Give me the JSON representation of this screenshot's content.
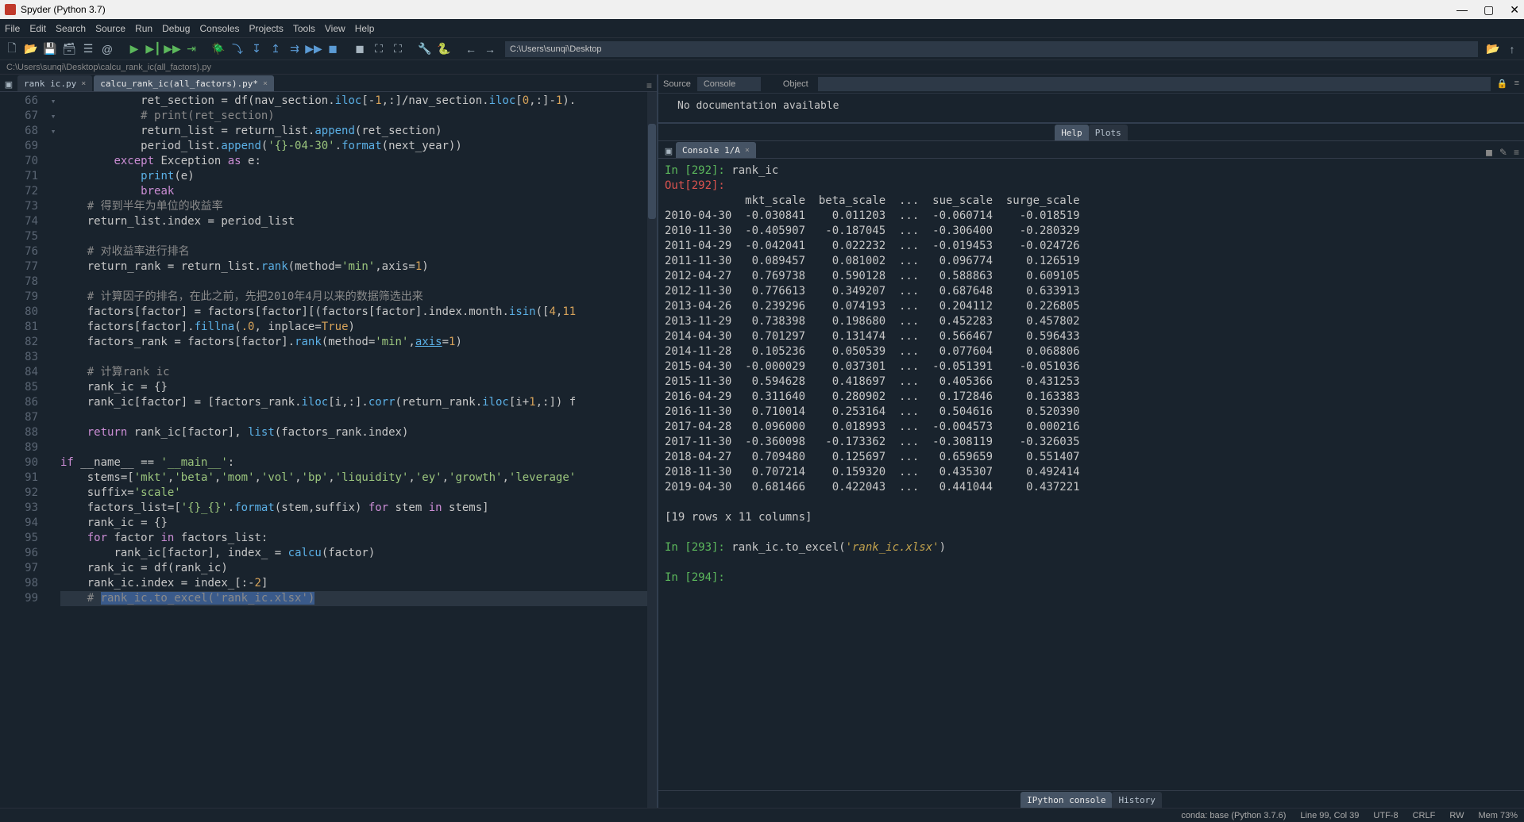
{
  "window_title": "Spyder (Python 3.7)",
  "menus": [
    "File",
    "Edit",
    "Search",
    "Source",
    "Run",
    "Debug",
    "Consoles",
    "Projects",
    "Tools",
    "View",
    "Help"
  ],
  "toolbar_path": "C:\\Users\\sunqi\\Desktop",
  "breadcrumb_path": "C:\\Users\\sunqi\\Desktop\\calcu_rank_ic(all_factors).py",
  "editor_tabs": {
    "inactive": "rank ic.py",
    "active": "calcu_rank_ic(all_factors).py*"
  },
  "lines": [
    66,
    67,
    68,
    69,
    70,
    71,
    72,
    73,
    74,
    75,
    76,
    77,
    78,
    79,
    80,
    81,
    82,
    83,
    84,
    85,
    86,
    87,
    88,
    89,
    90,
    91,
    92,
    93,
    94,
    95,
    96,
    97,
    98,
    99
  ],
  "src": {
    "source_label": "Source",
    "source_value": "Console",
    "object_label": "Object"
  },
  "doc_text": "No documentation available",
  "help_tabs": {
    "help": "Help",
    "plots": "Plots"
  },
  "console_tab": "Console 1/A",
  "console_output": {
    "in292": "In [292]:",
    "in292_cmd": " rank_ic",
    "out292": "Out[292]:",
    "header": "            mkt_scale  beta_scale  ...  sue_scale  surge_scale",
    "rows": [
      "2010-04-30  -0.030841    0.011203  ...  -0.060714    -0.018519",
      "2010-11-30  -0.405907   -0.187045  ...  -0.306400    -0.280329",
      "2011-04-29  -0.042041    0.022232  ...  -0.019453    -0.024726",
      "2011-11-30   0.089457    0.081002  ...   0.096774     0.126519",
      "2012-04-27   0.769738    0.590128  ...   0.588863     0.609105",
      "2012-11-30   0.776613    0.349207  ...   0.687648     0.633913",
      "2013-04-26   0.239296    0.074193  ...   0.204112     0.226805",
      "2013-11-29   0.738398    0.198680  ...   0.452283     0.457802",
      "2014-04-30   0.701297    0.131474  ...   0.566467     0.596433",
      "2014-11-28   0.105236    0.050539  ...   0.077604     0.068806",
      "2015-04-30  -0.000029    0.037301  ...  -0.051391    -0.051036",
      "2015-11-30   0.594628    0.418697  ...   0.405366     0.431253",
      "2016-04-29   0.311640    0.280902  ...   0.172846     0.163383",
      "2016-11-30   0.710014    0.253164  ...   0.504616     0.520390",
      "2017-04-28   0.096000    0.018993  ...  -0.004573     0.000216",
      "2017-11-30  -0.360098   -0.173362  ...  -0.308119    -0.326035",
      "2018-04-27   0.709480    0.125697  ...   0.659659     0.551407",
      "2018-11-30   0.707214    0.159320  ...   0.435307     0.492414",
      "2019-04-30   0.681466    0.422043  ...   0.441044     0.437221"
    ],
    "shape": "[19 rows x 11 columns]",
    "in293": "In [293]:",
    "in293_cmd": " rank_ic.to_excel(",
    "in293_str": "'rank_ic.xlsx'",
    "in293_end": ")",
    "in294": "In [294]:"
  },
  "bottom_tabs": {
    "ipy": "IPython console",
    "hist": "History"
  },
  "status": {
    "conda": "conda: base (Python 3.7.6)",
    "line": "Line 99, Col 39",
    "enc": "UTF-8",
    "eol": "CRLF",
    "rw": "RW",
    "mem": "Mem 73%"
  }
}
